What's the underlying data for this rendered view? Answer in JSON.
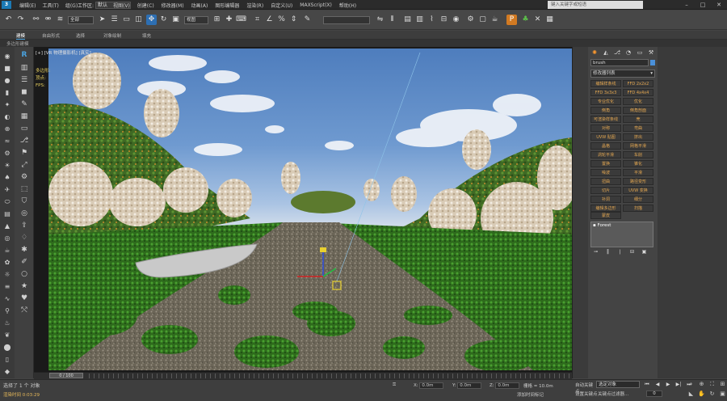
{
  "app": {
    "logo": "3",
    "title": "Autodesk 3ds Max 2017",
    "workspace_label": "工作区:",
    "workspace_value": "默认",
    "search_placeholder": "键入关键字或短语",
    "menus": [
      "编辑(E)",
      "工具(T)",
      "组(G)",
      "视图(V)",
      "创建(C)",
      "修改器(M)",
      "动画(A)",
      "图形编辑器",
      "渲染(R)",
      "自定义(U)",
      "MAXScript(X)",
      "帮助(H)"
    ],
    "window_controls": [
      "–",
      "□",
      "✕"
    ]
  },
  "toolbar": {
    "filter_select": "全部",
    "view_select": "视图",
    "selection_set": ""
  },
  "ribbon": {
    "tabs": [
      "建模",
      "自由形式",
      "选择",
      "对象绘制",
      "填充"
    ],
    "subtitle": "多边形建模"
  },
  "viewport": {
    "label": "[+] [VR 物理摄影机] [真实]",
    "overlay_lines": [
      "多边形:",
      "顶点:",
      "FPS:"
    ],
    "colors": {
      "sky_top": "#4e7dbd",
      "sky_horizon": "#cfdbea",
      "ground": "#4f6b2c",
      "path": "#6b6557",
      "boat": "#c9c9c9"
    }
  },
  "timeline": {
    "frame_label": "0 / 100"
  },
  "status": {
    "selection": "选择了 1 个 对象",
    "render_time": "渲染时间 0:03:29",
    "x_label": "X:",
    "x_value": "0.0m",
    "y_label": "Y:",
    "y_value": "0.0m",
    "z_label": "Z:",
    "z_value": "0.0m",
    "grid": "栅格 = 10.0m",
    "add_time_tag": "添加时间标记",
    "auto_key": "自动关键点",
    "selection_set": "选定对象",
    "set_key": "设置关键点",
    "key_filters": "关键点过滤器...",
    "frame": "0"
  },
  "command_panel": {
    "object_name": "brush",
    "object_color": "#4a90d9",
    "modifier_list": "修改器列表",
    "modifier_buttons": [
      "编辑样条线",
      "FFD 2x2x2",
      "FFD 3x3x3",
      "FFD 4x4x4",
      "专业优化",
      "优化",
      "倒角",
      "倒角剖面",
      "可渲染样条线",
      "壳",
      "对称",
      "弯曲",
      "UVW 贴图",
      "挤出",
      "晶格",
      "网格平滑",
      "涡轮平滑",
      "车削",
      "置换",
      "锥化",
      "噪波",
      "平滑",
      "扭曲",
      "路径变形",
      "切片",
      "UVW 变换",
      "补洞",
      "细分",
      "编辑多边形",
      "扫描"
    ],
    "extra_button": "蒙皮",
    "stack_item": "Forest"
  }
}
